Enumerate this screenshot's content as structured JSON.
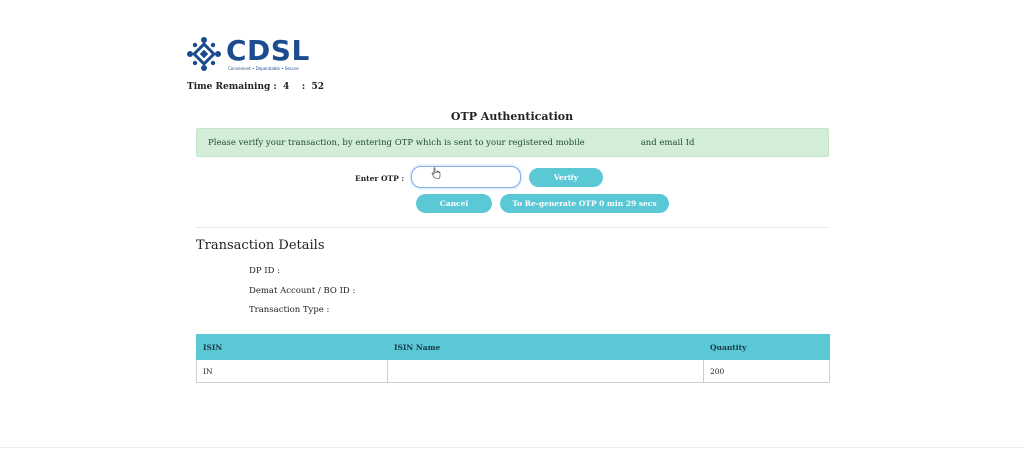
{
  "brand": {
    "name": "CDSL",
    "tagline": "Convenient  •  Dependable  •  Secure",
    "color": "#1b4c8f"
  },
  "timer": {
    "label": "Time Remaining :",
    "minutes": "4",
    "separator": ":",
    "seconds": "52"
  },
  "heading": "OTP Authentication",
  "alert": {
    "text_part1": "Please verify your transaction, by entering OTP which is sent to your registered mobile",
    "text_part2": "and email Id",
    "background": "#d4edd9"
  },
  "otp_form": {
    "label": "Enter OTP :",
    "value": "",
    "placeholder": "",
    "verify_label": "Verify",
    "cancel_label": "Cancel",
    "regenerate_label": "To Re-generate OTP 0 min 29 secs",
    "button_color": "#5bc8d6"
  },
  "transaction": {
    "title": "Transaction Details",
    "dp_id_label": "DP ID :",
    "bo_id_label": "Demat Account / BO ID :",
    "type_label": "Transaction Type :"
  },
  "table": {
    "headers": [
      "ISIN",
      "ISIN Name",
      "Quantity"
    ],
    "rows": [
      [
        "IN",
        "",
        "200"
      ]
    ]
  }
}
